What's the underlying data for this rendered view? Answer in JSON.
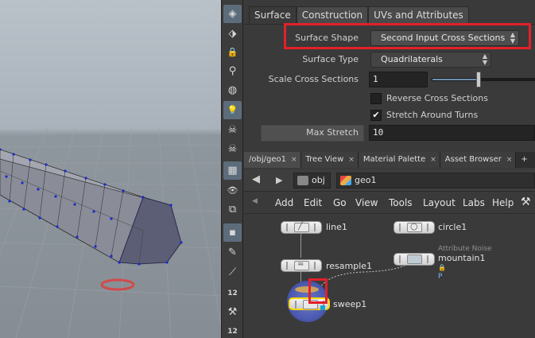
{
  "shelf": {
    "tools": [
      {
        "icon": "view-icon",
        "glyph": "◈"
      },
      {
        "icon": "handle-icon",
        "glyph": "⬗"
      },
      {
        "icon": "lock-icon",
        "glyph": "🔒"
      },
      {
        "icon": "snap-icon",
        "glyph": "⚲"
      },
      {
        "icon": "shade-icon",
        "glyph": "◍"
      },
      {
        "icon": "light-icon",
        "glyph": "💡"
      },
      {
        "icon": "skull-icon",
        "glyph": "☠"
      },
      {
        "icon": "skull2-icon",
        "glyph": "☠"
      },
      {
        "icon": "grid-icon",
        "glyph": "▦"
      },
      {
        "icon": "eye-icon",
        "glyph": "👁"
      },
      {
        "icon": "camera-icon",
        "glyph": "⧉"
      },
      {
        "icon": "point-icon",
        "glyph": "▪"
      },
      {
        "icon": "brush-icon",
        "glyph": "✎"
      },
      {
        "icon": "pen-icon",
        "glyph": "⟋"
      },
      {
        "icon": "num12-icon",
        "glyph": "12"
      },
      {
        "icon": "wrench-icon",
        "glyph": "⚒"
      },
      {
        "icon": "num12b-icon",
        "glyph": "12"
      }
    ]
  },
  "params": {
    "tabs": [
      "Surface",
      "Construction",
      "UVs and Attributes"
    ],
    "surface_shape": {
      "label": "Surface Shape",
      "value": "Second Input Cross Sections"
    },
    "surface_type": {
      "label": "Surface Type",
      "value": "Quadrilaterals"
    },
    "scale_cross_sections": {
      "label": "Scale Cross Sections",
      "value": "1",
      "slider_fraction": 0.5
    },
    "reverse_cross_sections": {
      "label": "Reverse Cross Sections",
      "checked": false
    },
    "stretch_around_turns": {
      "label": "Stretch Around Turns",
      "checked": true
    },
    "max_stretch": {
      "label": "Max Stretch",
      "value": "10"
    }
  },
  "network": {
    "tabs": [
      {
        "label": "/obj/geo1",
        "close": "×"
      },
      {
        "label": "Tree View",
        "close": "×"
      },
      {
        "label": "Material Palette",
        "close": "×"
      },
      {
        "label": "Asset Browser",
        "close": "×"
      }
    ],
    "add_tab": "+",
    "path": {
      "obj": "obj",
      "geo": "geo1"
    },
    "menu": [
      "Add",
      "Edit",
      "Go",
      "View",
      "Tools",
      "Layout",
      "Labs",
      "Help"
    ],
    "nodes": {
      "line1": "line1",
      "resample1": "resample1",
      "circle1": "circle1",
      "mountain_sub": "Attribute Noise",
      "mountain1": "mountain1",
      "mountain_param": "P",
      "sweep1": "sweep1"
    }
  },
  "colors": {
    "highlight": "#e3202a",
    "active_tool": "#5d6c7b",
    "selected_node": "#ffd700"
  }
}
